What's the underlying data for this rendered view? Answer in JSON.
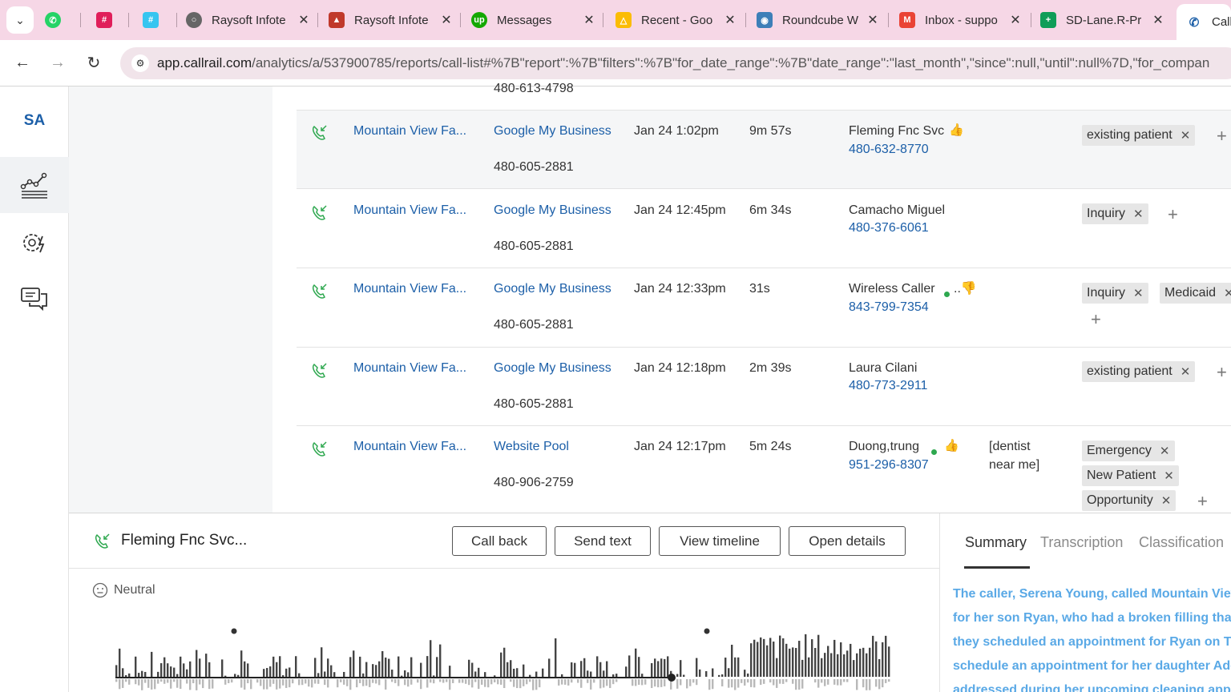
{
  "browser": {
    "tabs": [
      {
        "title": "",
        "icon": "whatsapp-icon",
        "color": "#25d366"
      },
      {
        "title": "",
        "icon": "slack-icon",
        "color": "#e01e5a"
      },
      {
        "title": "",
        "icon": "slack-icon",
        "color": "#36c5f0"
      },
      {
        "title": "Raysoft Infote",
        "icon": "globe-icon",
        "color": "#555555"
      },
      {
        "title": "Raysoft Infote",
        "icon": "graduation-cap-icon",
        "color": "#c0392b"
      },
      {
        "title": "Messages",
        "icon": "upwork-icon",
        "color": "#14a800"
      },
      {
        "title": "Recent - Goo",
        "icon": "google-drive-icon",
        "color": "#fbbc04"
      },
      {
        "title": "Roundcube W",
        "icon": "roundcube-icon",
        "color": "#3d7fb8"
      },
      {
        "title": "Inbox - suppo",
        "icon": "gmail-icon",
        "color": "#ea4335"
      },
      {
        "title": "SD-Lane.R-Pr",
        "icon": "google-sheets-icon",
        "color": "#0f9d58"
      },
      {
        "title": "Call",
        "icon": "callrail-icon",
        "color": "#1c5fa8"
      }
    ],
    "url_host": "app.callrail.com",
    "url_path": "/analytics/a/537900785/reports/call-list#%7B\"report\":%7B\"filters\":%7B\"for_date_range\":%7B\"date_range\":\"last_month\",\"since\":null,\"until\":null%7D,\"for_compan"
  },
  "sidebar": {
    "logo": "SA",
    "items": [
      {
        "name": "analytics",
        "icon": "analytics-chart-icon",
        "active": true
      },
      {
        "name": "settings",
        "icon": "gear-bolt-icon",
        "active": false
      },
      {
        "name": "conversations",
        "icon": "chat-bubbles-icon",
        "active": false
      }
    ]
  },
  "partial_row": {
    "tracking_number": "480-613-4798"
  },
  "rows": [
    {
      "company": "Mountain View Fa...",
      "source": "Google My Business",
      "tracking_number": "480-605-2881",
      "time": "Jan 24 1:02pm",
      "duration": "9m 57s",
      "caller": "Fleming Fnc Svc",
      "caller_number": "480-632-8770",
      "indicators": "thumbs-up",
      "keywords": [],
      "tags": [
        "existing patient"
      ],
      "selected": true
    },
    {
      "company": "Mountain View Fa...",
      "source": "Google My Business",
      "tracking_number": "480-605-2881",
      "time": "Jan 24 12:45pm",
      "duration": "6m 34s",
      "caller": "Camacho Miguel",
      "caller_number": "480-376-6061",
      "indicators": "",
      "keywords": [],
      "tags": [
        "Inquiry"
      ],
      "selected": false
    },
    {
      "company": "Mountain View Fa...",
      "source": "Google My Business",
      "tracking_number": "480-605-2881",
      "time": "Jan 24 12:33pm",
      "duration": "31s",
      "caller": "Wireless Caller",
      "caller_number": "843-799-7354",
      "indicators": "dot-thumbs-down",
      "keywords": [],
      "tags": [
        "Inquiry",
        "Medicaid"
      ],
      "selected": false
    },
    {
      "company": "Mountain View Fa...",
      "source": "Google My Business",
      "tracking_number": "480-605-2881",
      "time": "Jan 24 12:18pm",
      "duration": "2m 39s",
      "caller": "Laura Cilani",
      "caller_number": "480-773-2911",
      "indicators": "",
      "keywords": [],
      "tags": [
        "existing patient"
      ],
      "selected": false
    },
    {
      "company": "Mountain View Fa...",
      "source": "Website Pool",
      "tracking_number": "480-906-2759",
      "time": "Jan 24 12:17pm",
      "duration": "5m 24s",
      "caller": "Duong,trung",
      "caller_number": "951-296-8307",
      "indicators": "dot-thumbs-up",
      "keywords": [
        "[dentist",
        "near me]"
      ],
      "tags": [
        "Emergency",
        "New Patient",
        "Opportunity"
      ],
      "selected": false
    }
  ],
  "detail": {
    "caller": "Fleming Fnc Svc...",
    "buttons": {
      "call_back": "Call back",
      "send_text": "Send text",
      "view_timeline": "View timeline",
      "open_details": "Open details"
    },
    "sentiment": "Neutral",
    "tabs": {
      "summary": "Summary",
      "transcription": "Transcription",
      "classification": "Classification"
    },
    "summary_lines": [
      "The caller, Serena Young, called Mountain View",
      "for her son Ryan, who had a broken filling that",
      "they scheduled an appointment for Ryan on Tu",
      "schedule an appointment for her daughter Ade",
      "addressed during her upcoming cleaning appo"
    ]
  },
  "colors": {
    "link": "#1c5fa8",
    "accent_green": "#2ea84f",
    "summary_text": "#5aa9e6",
    "tab_strip": "#f6d7e6"
  }
}
